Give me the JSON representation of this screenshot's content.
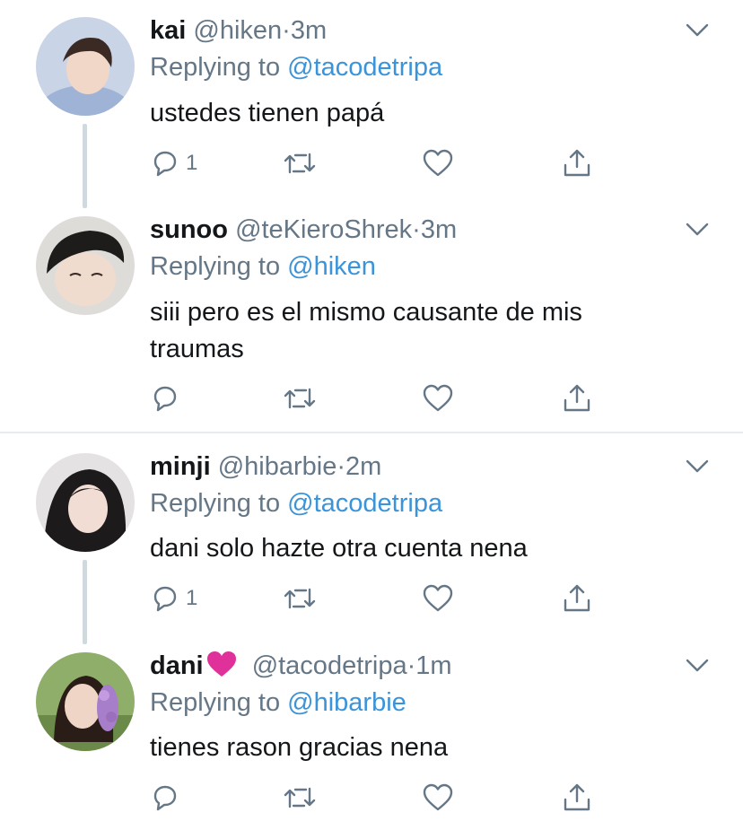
{
  "tweets": [
    {
      "name": "kai",
      "handle": "@hiken",
      "dot": "·",
      "time": "3m",
      "replying_prefix": "Replying to",
      "replying_to": "@tacodetripa",
      "text": "ustedes tienen papá",
      "reply_count": "1"
    },
    {
      "name": "sunoo",
      "handle": "@teKieroShrek",
      "dot": "·",
      "time": "3m",
      "replying_prefix": "Replying to",
      "replying_to": "@hiken",
      "text": "siii pero es el mismo causante de mis traumas",
      "reply_count": ""
    },
    {
      "name": "minji",
      "handle": "@hibarbie",
      "dot": "·",
      "time": "2m",
      "replying_prefix": "Replying to",
      "replying_to": "@tacodetripa",
      "text": "dani solo hazte otra cuenta nena",
      "reply_count": "1"
    },
    {
      "name": "dani",
      "name_emoji": "pink-heart-icon",
      "handle": "@tacodetripa",
      "dot": "·",
      "time": "1m",
      "replying_prefix": "Replying to",
      "replying_to": "@hibarbie",
      "text": "tienes rason gracias nena",
      "reply_count": ""
    }
  ],
  "colors": {
    "secondary_text": "#657786",
    "mention": "#3b94d9",
    "heart_emoji": "#e0309a",
    "thread_line": "#cfd9de"
  }
}
